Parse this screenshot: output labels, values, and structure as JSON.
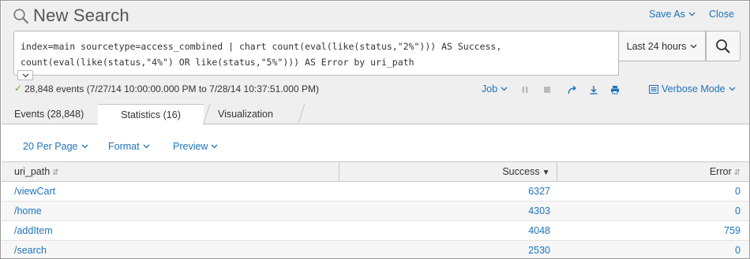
{
  "header": {
    "title": "New Search",
    "save_as": "Save As",
    "close": "Close"
  },
  "search": {
    "query_line1": "index=main sourcetype=access_combined | chart count(eval(like(status,\"2%\"))) AS Success,",
    "query_line2": "count(eval(like(status,\"4%\") OR like(status,\"5%\"))) AS Error by uri_path",
    "time_range": "Last 24 hours"
  },
  "status": {
    "summary": "28,848 events (7/27/14 10:00:00.000 PM to 7/28/14 10:37:51.000 PM)",
    "job": "Job",
    "mode": "Verbose Mode"
  },
  "tabs": {
    "events": "Events (28,848)",
    "statistics": "Statistics (16)",
    "visualization": "Visualization"
  },
  "controls": {
    "per_page": "20 Per Page",
    "format": "Format",
    "preview": "Preview"
  },
  "table": {
    "columns": [
      "uri_path",
      "Success",
      "Error"
    ],
    "rows": [
      [
        "/viewCart",
        "6327",
        "0"
      ],
      [
        "/home",
        "4303",
        "0"
      ],
      [
        "/addItem",
        "4048",
        "759"
      ],
      [
        "/search",
        "2530",
        "0"
      ]
    ]
  },
  "colors": {
    "link": "#1e73be",
    "success_check": "#65a637",
    "header_bg": "#efefef"
  },
  "icons": {
    "title": "search-icon",
    "save_as": "chevron-down-icon",
    "search_button": "search-icon",
    "pause": "pause-icon",
    "stop": "stop-icon",
    "share": "share-icon",
    "export": "download-icon",
    "print": "print-icon",
    "mode": "list-icon"
  }
}
